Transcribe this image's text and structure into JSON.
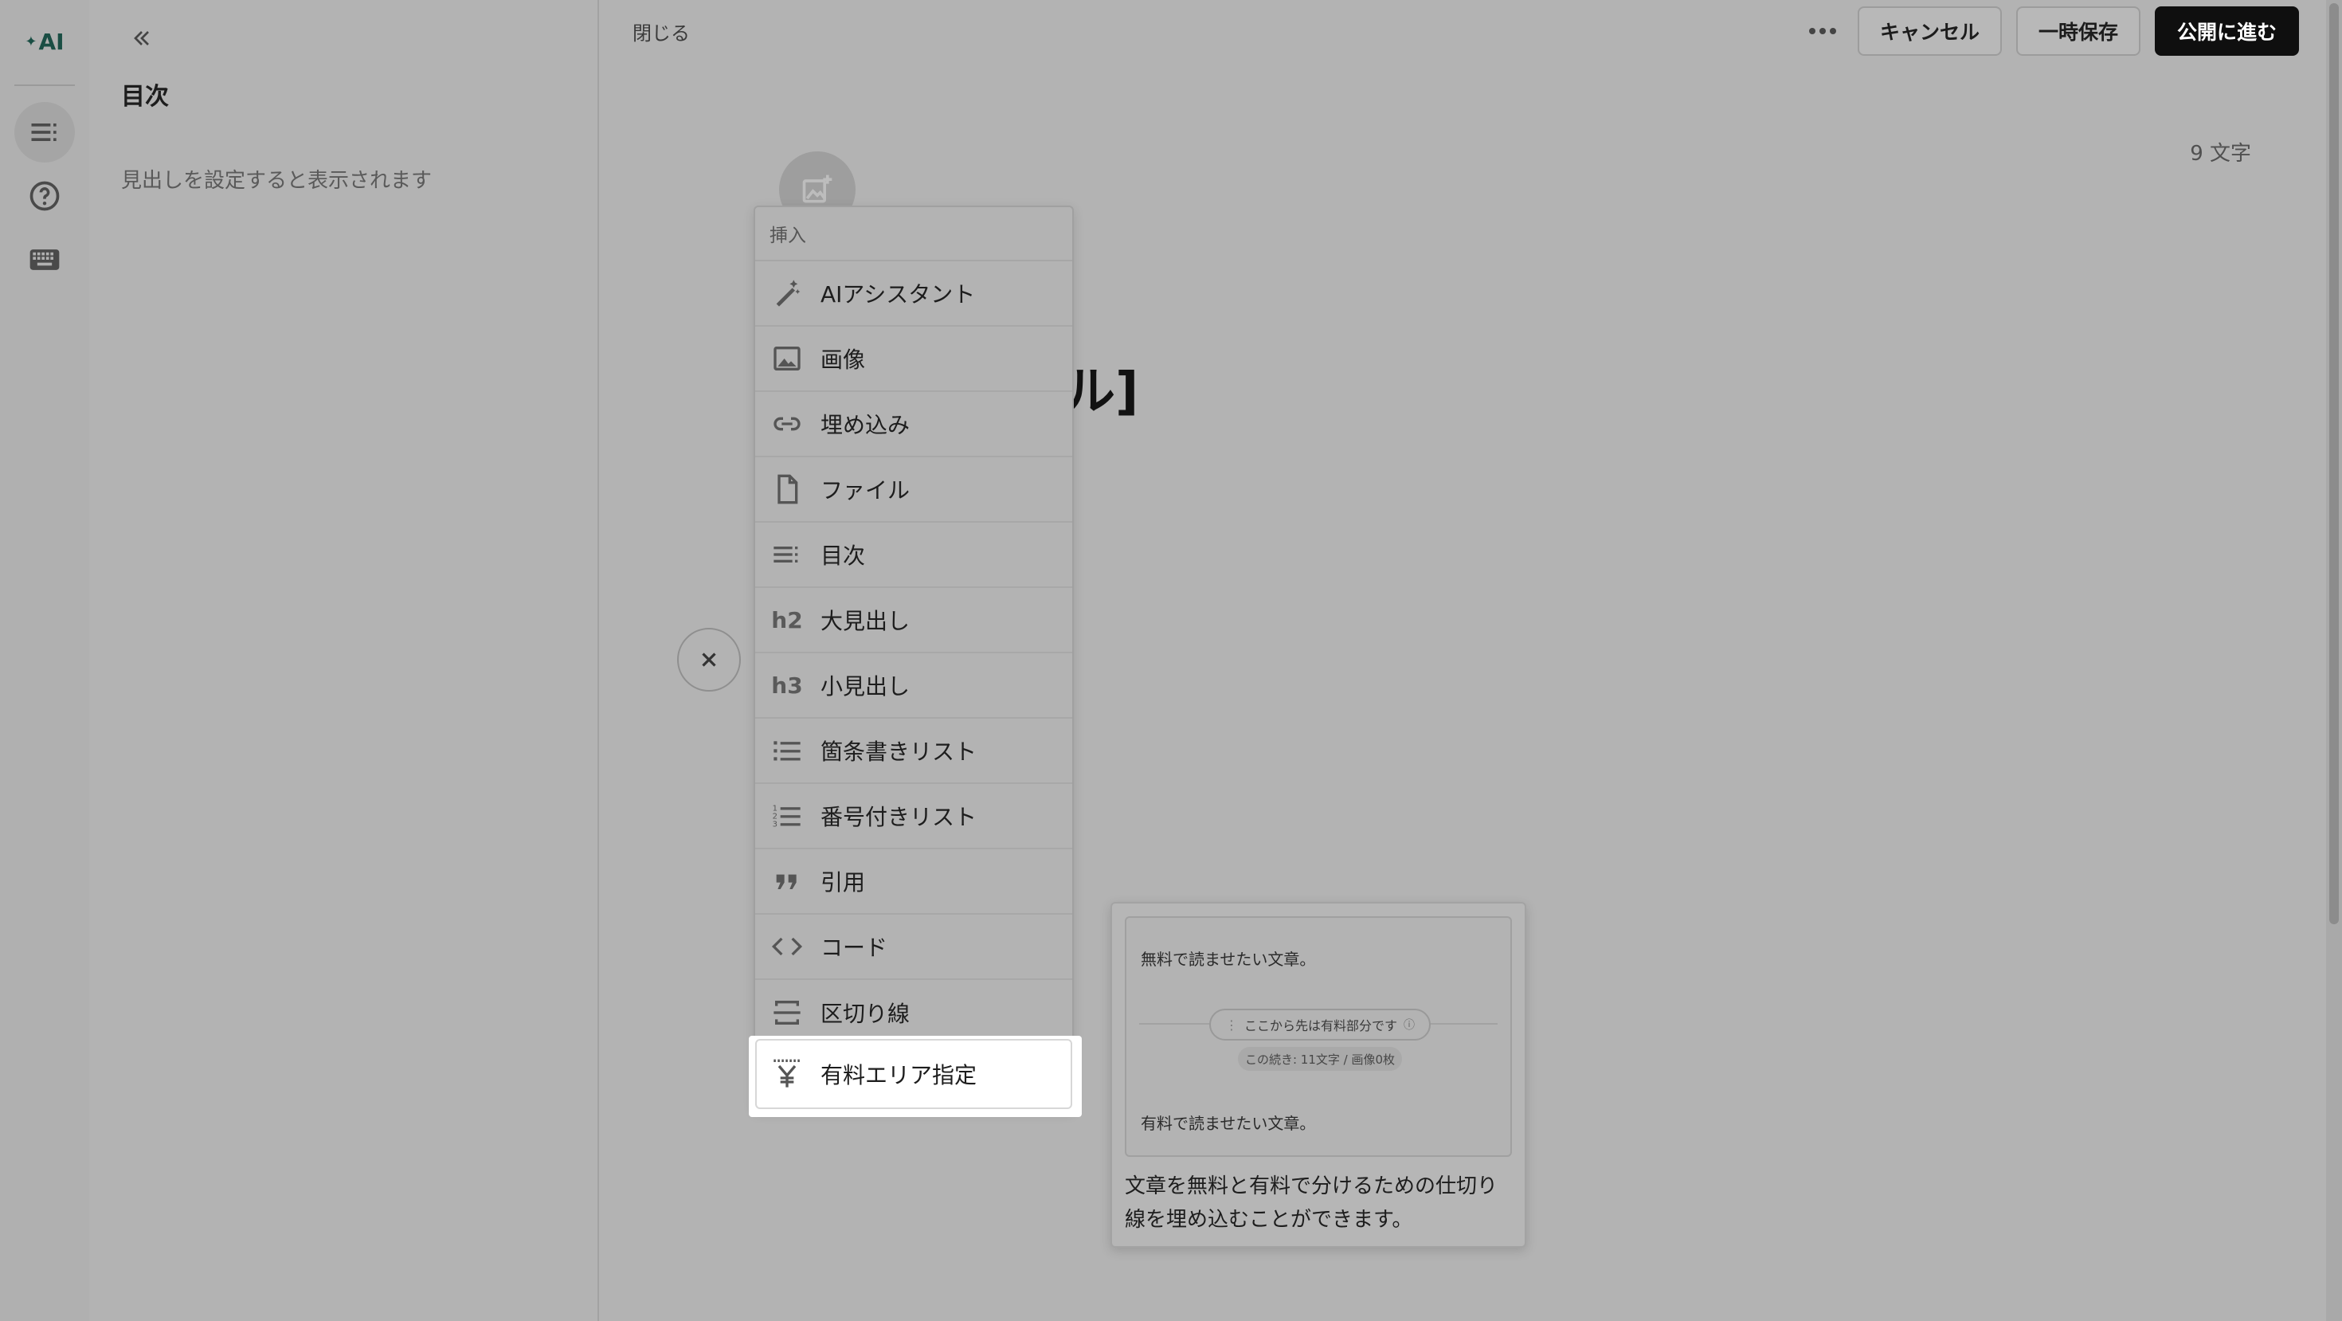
{
  "rail": {
    "logo_label": "AI",
    "items": [
      {
        "icon": "toc-icon",
        "active": true
      },
      {
        "icon": "help-circle-icon",
        "active": false
      },
      {
        "icon": "keyboard-icon",
        "active": false
      }
    ]
  },
  "toc_panel": {
    "title": "目次",
    "hint": "見出しを設定すると表示されます"
  },
  "editor": {
    "close_label": "閉じる",
    "cancel_label": "キャンセル",
    "save_draft_label": "一時保存",
    "publish_label": "公開に進む",
    "char_count": "9 文字",
    "title_fragment": "ル]"
  },
  "insert_menu": {
    "header": "挿入",
    "items": [
      {
        "label": "AIアシスタント",
        "icon": "magic-wand-icon"
      },
      {
        "label": "画像",
        "icon": "image-icon"
      },
      {
        "label": "埋め込み",
        "icon": "link-icon"
      },
      {
        "label": "ファイル",
        "icon": "file-icon"
      },
      {
        "label": "目次",
        "icon": "toc-icon"
      },
      {
        "label": "大見出し",
        "icon": "h2-icon",
        "icon_text": "h2"
      },
      {
        "label": "小見出し",
        "icon": "h3-icon",
        "icon_text": "h3"
      },
      {
        "label": "箇条書きリスト",
        "icon": "bullet-list-icon"
      },
      {
        "label": "番号付きリスト",
        "icon": "numbered-list-icon"
      },
      {
        "label": "引用",
        "icon": "quote-icon"
      },
      {
        "label": "コード",
        "icon": "code-icon"
      },
      {
        "label": "区切り線",
        "icon": "divider-icon"
      }
    ],
    "highlighted_item": {
      "label": "有料エリア指定",
      "icon": "yen-icon"
    }
  },
  "preview": {
    "free_text": "無料で読ませたい文章。",
    "divider_text": "ここから先は有料部分です",
    "stats_text": "この続き: 11文字 / 画像0枚",
    "paid_text": "有料で読ませたい文章。",
    "description": "文章を無料と有料で分けるための仕切り線を埋め込むことができます。"
  },
  "colors": {
    "publish_bg": "#0f0f0f",
    "logo": "#1a4e44",
    "overlay_gray": "#b3b3b3"
  }
}
